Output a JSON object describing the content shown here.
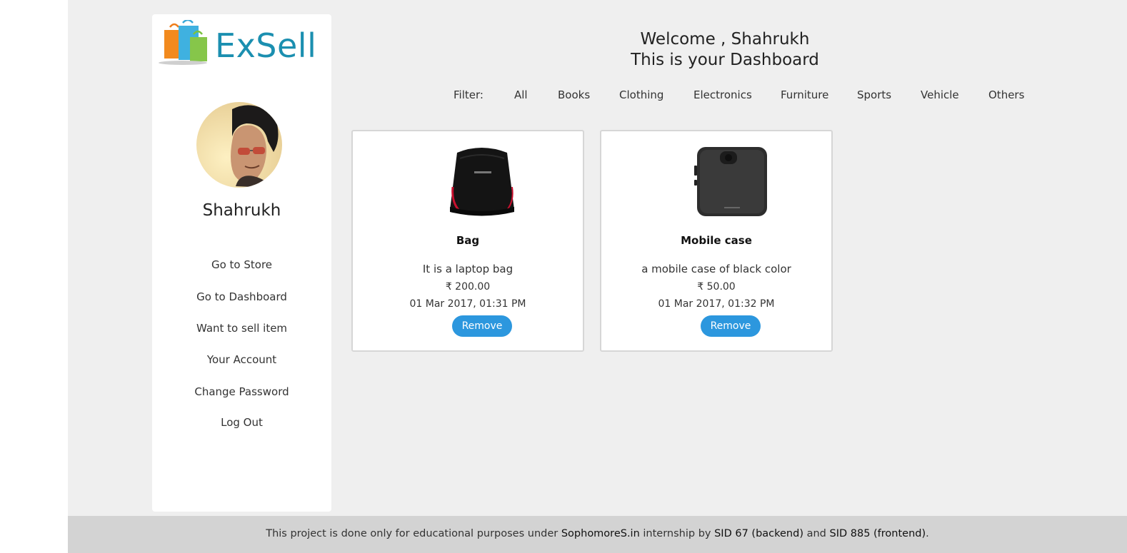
{
  "brand": {
    "logo_text": "ExSell"
  },
  "sidebar": {
    "username": "Shahrukh",
    "nav": [
      {
        "label": "Go to Store"
      },
      {
        "label": "Go to Dashboard"
      },
      {
        "label": "Want to sell item"
      },
      {
        "label": "Your Account"
      },
      {
        "label": "Change Password"
      },
      {
        "label": "Log Out"
      }
    ]
  },
  "header": {
    "welcome_line1": "Welcome , Shahrukh",
    "welcome_line2": "This is your Dashboard"
  },
  "filter": {
    "label": "Filter:",
    "options": [
      "All",
      "Books",
      "Clothing",
      "Electronics",
      "Furniture",
      "Sports",
      "Vehicle",
      "Others"
    ]
  },
  "items": [
    {
      "name": "Bag",
      "description": "It is a laptop bag",
      "price": "₹ 200.00",
      "date": "01 Mar 2017, 01:31 PM",
      "action": "Remove"
    },
    {
      "name": "Mobile case",
      "description": "a mobile case of black color",
      "price": "₹ 50.00",
      "date": "01 Mar 2017, 01:32 PM",
      "action": "Remove"
    }
  ],
  "footer": {
    "text1": "This project is done only for educational purposes under ",
    "site": "SophomoreS.in",
    "text2": " internship by ",
    "backend": "SID 67 (backend)",
    "text3": " and ",
    "frontend": "SID 885 (frontend)",
    "text4": "."
  },
  "colors": {
    "accent": "#2c97de",
    "logo": "#1b8fb0",
    "background": "#efefef",
    "footer": "#d3d3d3"
  }
}
